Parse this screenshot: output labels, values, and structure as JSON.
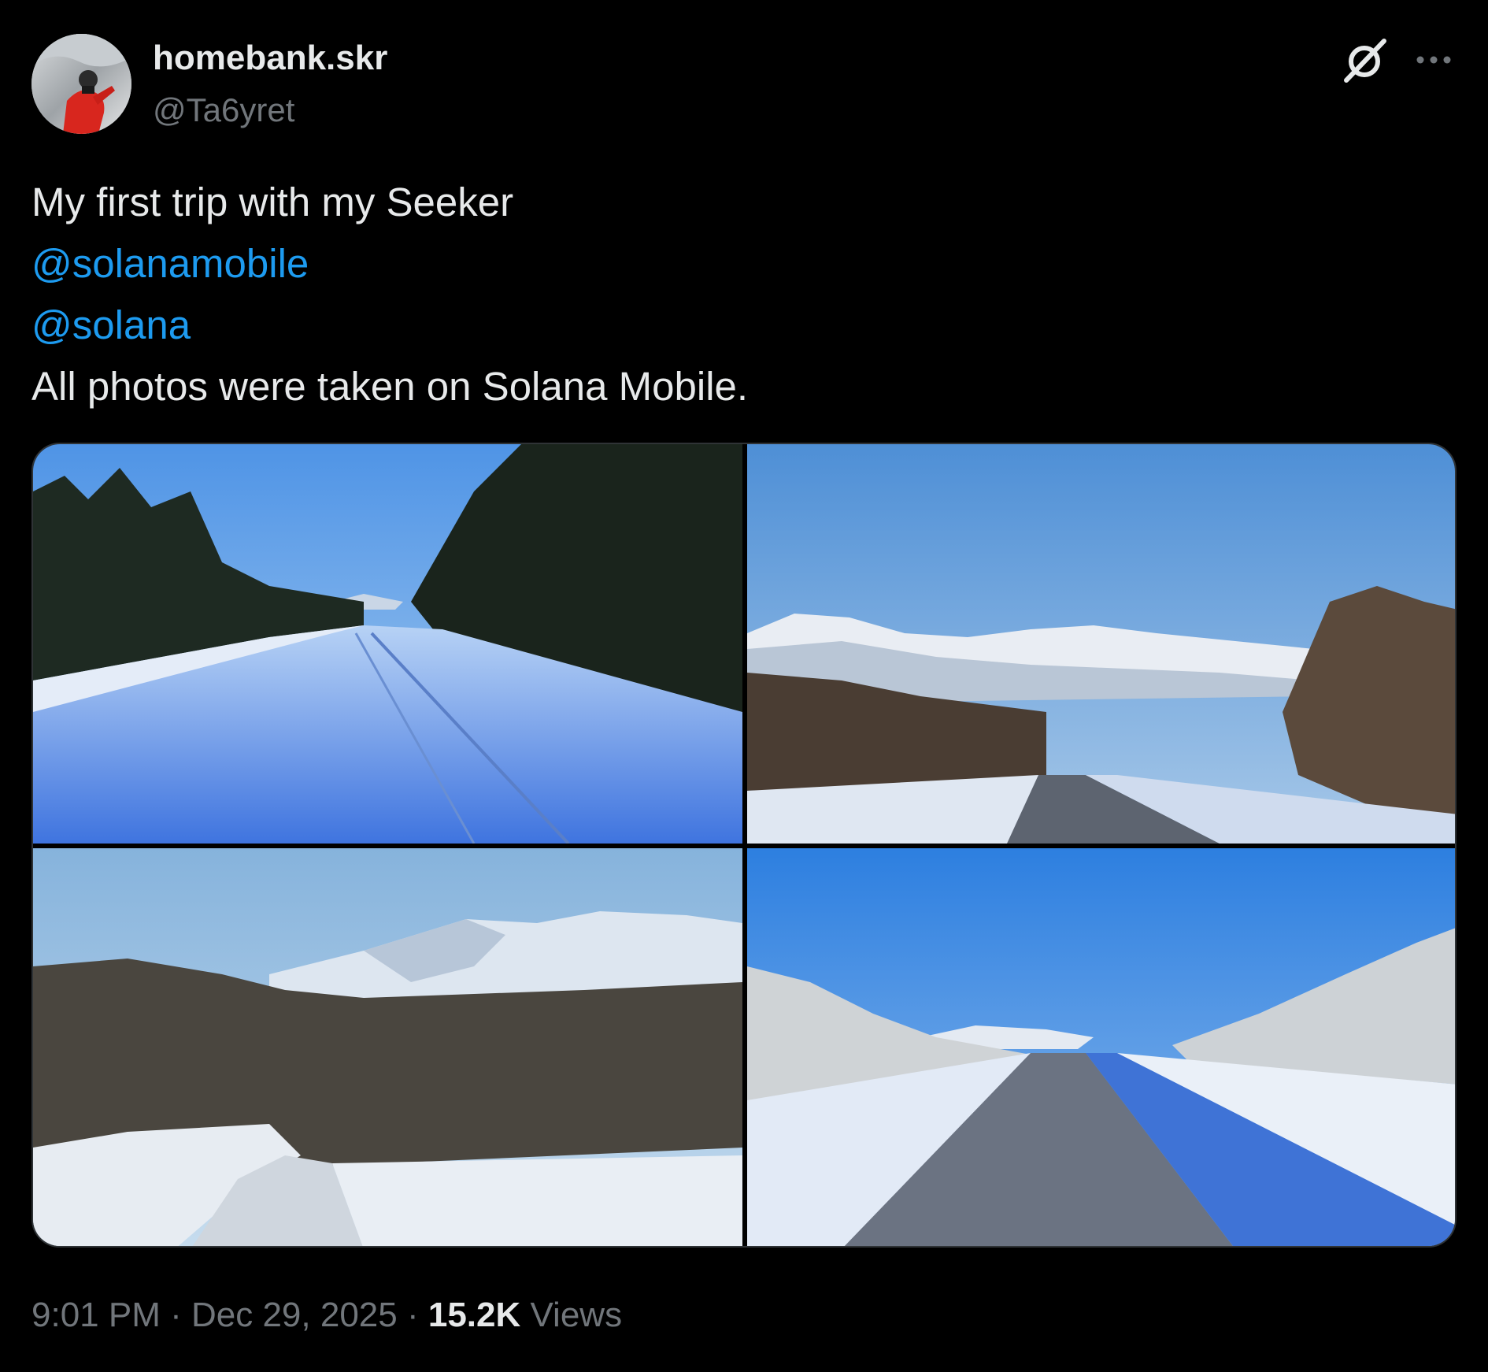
{
  "author": {
    "display_name": "homebank.skr",
    "handle": "@Ta6yret"
  },
  "tweet": {
    "text_line1": "My first trip with my Seeker",
    "mention1": "@solanamobile",
    "mention2": "@solana",
    "text_line4": "All photos were taken on Solana Mobile."
  },
  "meta": {
    "time": "9:01 PM",
    "separator1": " · ",
    "date": "Dec 29, 2025",
    "separator2": " · ",
    "views_count": "15.2K",
    "views_label": " Views"
  },
  "icons": {
    "grok": "grok-icon",
    "more": "more-dots-icon"
  },
  "colors": {
    "background": "#000000",
    "text_primary": "#e7e9ea",
    "text_secondary": "#71767b",
    "link": "#1d9bf0",
    "border": "#2f3336"
  }
}
